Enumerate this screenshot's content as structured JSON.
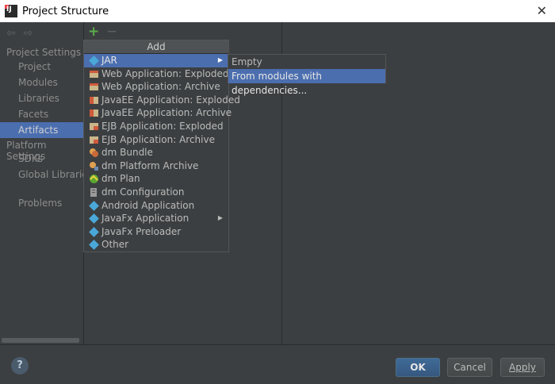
{
  "window": {
    "title": "Project Structure",
    "close_glyph": "✕"
  },
  "nav": {
    "back_glyph": "⇦",
    "forward_glyph": "⇨"
  },
  "sidebar": {
    "project_settings_label": "Project Settings",
    "project_items": [
      {
        "label": "Project"
      },
      {
        "label": "Modules"
      },
      {
        "label": "Libraries"
      },
      {
        "label": "Facets"
      },
      {
        "label": "Artifacts"
      }
    ],
    "platform_settings_label": "Platform Settings",
    "platform_items": [
      {
        "label": "SDKs"
      },
      {
        "label": "Global Libraries"
      }
    ],
    "problems_label": "Problems",
    "selected": "Artifacts"
  },
  "toolbar": {
    "add_glyph": "+",
    "remove_glyph": "−"
  },
  "add_menu": {
    "header": "Add",
    "items": [
      {
        "label": "JAR",
        "icon": "jar-icon",
        "has_submenu": true,
        "selected": true
      },
      {
        "label": "Web Application: Exploded",
        "icon": "web-app-icon"
      },
      {
        "label": "Web Application: Archive",
        "icon": "web-app-icon"
      },
      {
        "label": "JavaEE Application: Exploded",
        "icon": "javaee-icon"
      },
      {
        "label": "JavaEE Application: Archive",
        "icon": "javaee-icon"
      },
      {
        "label": "EJB Application: Exploded",
        "icon": "ejb-icon"
      },
      {
        "label": "EJB Application: Archive",
        "icon": "ejb-icon"
      },
      {
        "label": "dm Bundle",
        "icon": "dm-bundle-icon"
      },
      {
        "label": "dm Platform Archive",
        "icon": "dm-platform-icon"
      },
      {
        "label": "dm Plan",
        "icon": "dm-plan-icon"
      },
      {
        "label": "dm Configuration",
        "icon": "dm-config-icon"
      },
      {
        "label": "Android Application",
        "icon": "android-icon"
      },
      {
        "label": "JavaFx Application",
        "icon": "javafx-icon",
        "has_submenu": true
      },
      {
        "label": "JavaFx Preloader",
        "icon": "javafx-icon"
      },
      {
        "label": "Other",
        "icon": "other-icon"
      }
    ]
  },
  "jar_submenu": {
    "items": [
      {
        "label": "Empty"
      },
      {
        "label": "From modules with dependencies...",
        "selected": true
      }
    ]
  },
  "footer": {
    "help_glyph": "?",
    "ok_label": "OK",
    "cancel_label": "Cancel",
    "apply_label": "Apply"
  },
  "colors": {
    "background": "#3c3f41",
    "selection": "#4b6eaf",
    "add_green": "#5bab4a",
    "text": "#bbbbbb"
  }
}
